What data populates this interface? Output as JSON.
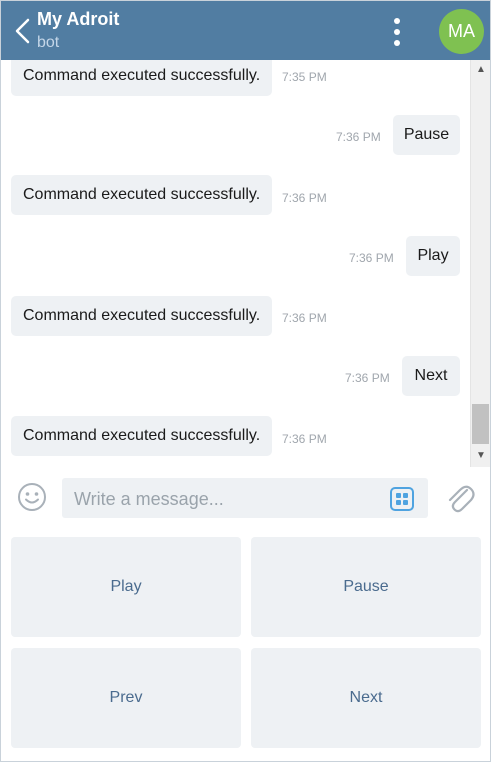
{
  "header": {
    "title": "My Adroit",
    "subtitle": "bot",
    "avatar_initials": "MA",
    "avatar_color": "#7fc151",
    "bar_color": "#517da2"
  },
  "messages": [
    {
      "side": "in",
      "text": "Command executed successfully.",
      "time": "7:35 PM"
    },
    {
      "side": "out",
      "text": "Pause",
      "time": "7:36 PM"
    },
    {
      "side": "in",
      "text": "Command executed successfully.",
      "time": "7:36 PM"
    },
    {
      "side": "out",
      "text": "Play",
      "time": "7:36 PM"
    },
    {
      "side": "in",
      "text": "Command executed successfully.",
      "time": "7:36 PM"
    },
    {
      "side": "out",
      "text": "Next",
      "time": "7:36 PM"
    },
    {
      "side": "in",
      "text": "Command executed successfully.",
      "time": "7:36 PM"
    }
  ],
  "composer": {
    "placeholder": "Write a message..."
  },
  "keyboard": [
    {
      "label": "Play"
    },
    {
      "label": "Pause"
    },
    {
      "label": "Prev"
    },
    {
      "label": "Next"
    }
  ],
  "icons": {
    "back": "chevron-left-icon",
    "menu": "more-vertical-icon",
    "emoji": "smiley-icon",
    "bot_keyboard": "keyboard-grid-icon",
    "attach": "paperclip-icon"
  }
}
